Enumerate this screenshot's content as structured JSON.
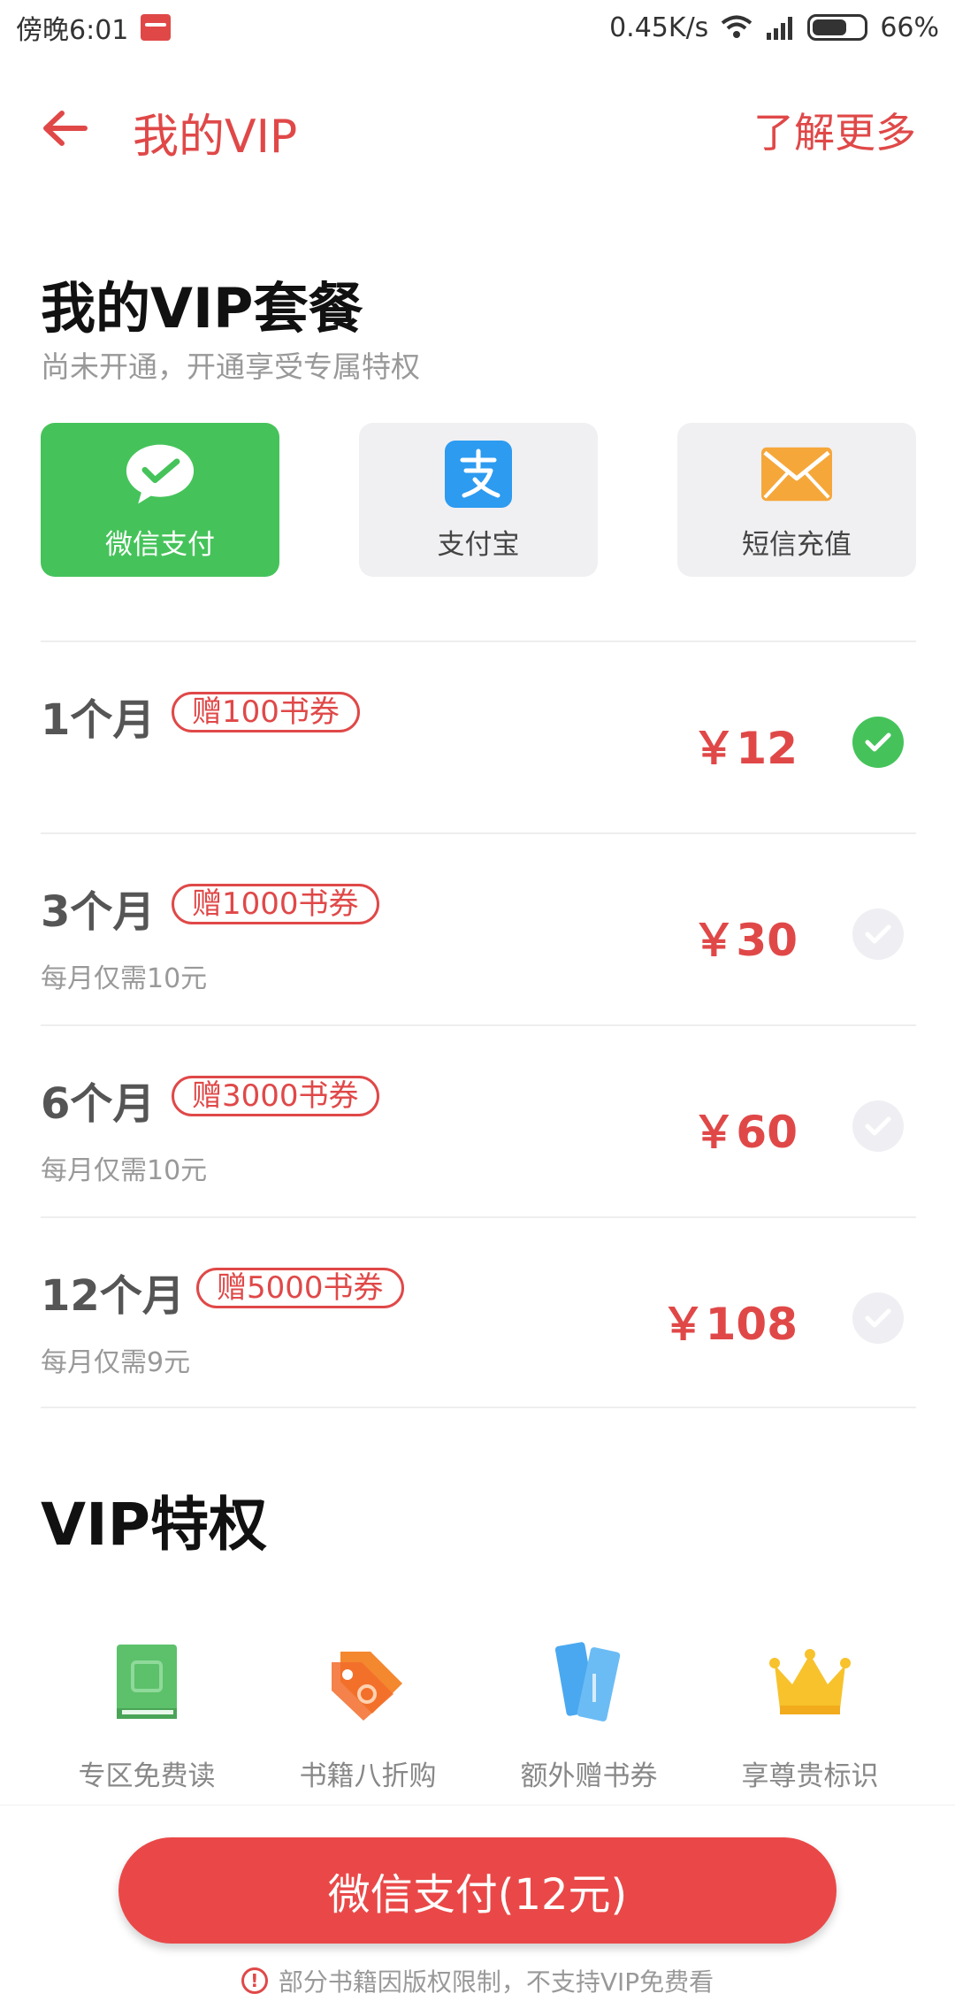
{
  "status_bar": {
    "time": "傍晚6:01",
    "network_speed": "0.45K/s",
    "battery": "66%"
  },
  "header": {
    "title": "我的VIP",
    "learn_more": "了解更多"
  },
  "vip_package": {
    "title": "我的VIP套餐",
    "subtitle": "尚未开通，开通享受专属特权"
  },
  "payment_methods": [
    {
      "label": "微信支付",
      "icon": "wechat-icon",
      "selected": true
    },
    {
      "label": "支付宝",
      "icon": "alipay-icon",
      "selected": false
    },
    {
      "label": "短信充值",
      "icon": "sms-envelope-icon",
      "selected": false
    }
  ],
  "plans": [
    {
      "name": "1个月",
      "gift": "赠100书券",
      "note": "",
      "price": "￥12",
      "selected": true
    },
    {
      "name": "3个月",
      "gift": "赠1000书券",
      "note": "每月仅需10元",
      "price": "￥30",
      "selected": false
    },
    {
      "name": "6个月",
      "gift": "赠3000书券",
      "note": "每月仅需10元",
      "price": "￥60",
      "selected": false
    },
    {
      "name": "12个月",
      "gift": "赠5000书券",
      "note": "每月仅需9元",
      "price": "￥108",
      "selected": false
    }
  ],
  "privileges": {
    "title": "VIP特权",
    "items": [
      {
        "label": "专区免费读",
        "icon": "free-book-icon"
      },
      {
        "label": "书籍八折购",
        "icon": "discount-tag-icon"
      },
      {
        "label": "额外赠书券",
        "icon": "coupon-ticket-icon"
      },
      {
        "label": "享尊贵标识",
        "icon": "crown-icon"
      }
    ]
  },
  "bottom": {
    "pay_button": "微信支付(12元)",
    "notice": "部分书籍因版权限制，不支持VIP免费看"
  },
  "colors": {
    "accent": "#e04848",
    "wechat_green": "#45c35a",
    "muted_bg": "#f0f0f3"
  }
}
